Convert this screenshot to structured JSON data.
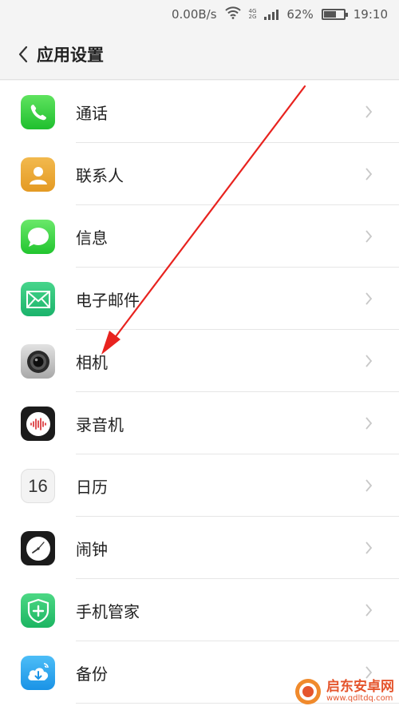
{
  "status_bar": {
    "speed": "0.00B/s",
    "net_top": "4G",
    "net_bottom": "2G",
    "battery_percent_text": "62%",
    "battery_level": 0.62,
    "time": "19:10"
  },
  "header": {
    "title": "应用设置"
  },
  "settings_items": [
    {
      "label": "通话",
      "icon": "phone-icon"
    },
    {
      "label": "联系人",
      "icon": "contacts-icon"
    },
    {
      "label": "信息",
      "icon": "message-icon"
    },
    {
      "label": "电子邮件",
      "icon": "mail-icon"
    },
    {
      "label": "相机",
      "icon": "camera-icon"
    },
    {
      "label": "录音机",
      "icon": "recorder-icon"
    },
    {
      "label": "日历",
      "icon": "calendar-icon",
      "icon_text": "16"
    },
    {
      "label": "闹钟",
      "icon": "clock-icon"
    },
    {
      "label": "手机管家",
      "icon": "security-icon"
    },
    {
      "label": "备份",
      "icon": "backup-icon"
    }
  ],
  "watermark": {
    "name": "启东安卓网",
    "url": "www.qdltdq.com"
  },
  "colors": {
    "accent_red": "#e8231f",
    "watermark": "#e5552d"
  }
}
